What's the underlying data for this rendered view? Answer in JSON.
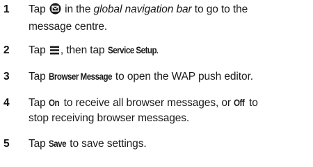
{
  "steps": [
    {
      "number": "1",
      "before_icon": "Tap ",
      "icon": "message-centre-icon",
      "after_icon": " in the ",
      "italic": "global navigation bar",
      "line1_end": " to go to the",
      "line2": "message centre."
    },
    {
      "number": "2",
      "before_icon": "Tap ",
      "icon": "menu-icon",
      "mid": ", then tap ",
      "bold": "Service Setup",
      "end": "."
    },
    {
      "number": "3",
      "before": "Tap ",
      "bold": "Browser Message",
      "end": " to open the WAP push editor."
    },
    {
      "number": "4",
      "before": "Tap ",
      "bold_on": "On",
      "middle": " to receive all browser messages, or ",
      "bold_off": "Off",
      "end": " to",
      "line2": "stop receiving browser messages."
    },
    {
      "number": "5",
      "before": "Tap ",
      "bold": "Save",
      "end": " to save settings."
    }
  ]
}
